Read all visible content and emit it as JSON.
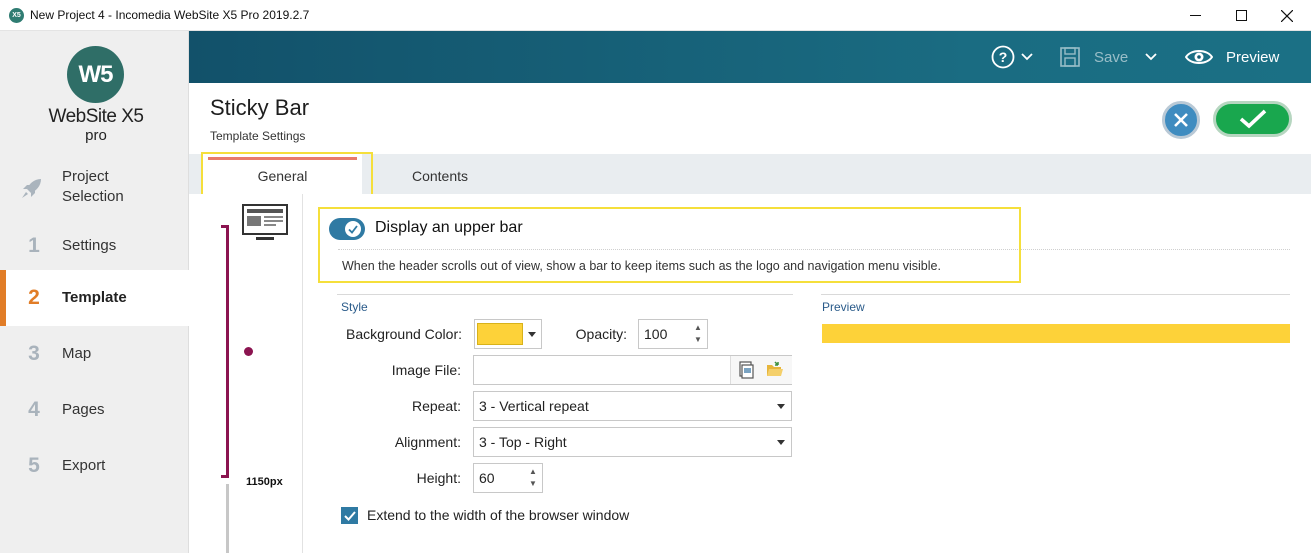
{
  "window": {
    "title": "New Project 4 - Incomedia WebSite X5 Pro 2019.2.7",
    "app_icon_text": "X5"
  },
  "logo": {
    "mark": "W5",
    "name": "WebSite X5",
    "edition": "pro"
  },
  "sidebar": {
    "project_label": "Project Selection",
    "steps": [
      {
        "num": "1",
        "label": "Settings"
      },
      {
        "num": "2",
        "label": "Template"
      },
      {
        "num": "3",
        "label": "Map"
      },
      {
        "num": "4",
        "label": "Pages"
      },
      {
        "num": "5",
        "label": "Export"
      }
    ],
    "active_step": "Template"
  },
  "toolbar": {
    "save_label": "Save",
    "preview_label": "Preview"
  },
  "header": {
    "title": "Sticky Bar",
    "subtitle": "Template Settings"
  },
  "tabs": {
    "general": "General",
    "contents": "Contents",
    "active": "General"
  },
  "device": {
    "width_label": "1150px"
  },
  "upper_bar": {
    "label": "Display an upper bar",
    "enabled": true,
    "description": "When the header scrolls out of view, show a bar to keep items such as the logo and navigation menu visible."
  },
  "style": {
    "section_label": "Style",
    "background_color_label": "Background Color:",
    "background_color": "#fdd239",
    "opacity_label": "Opacity:",
    "opacity_value": "100",
    "image_file_label": "Image File:",
    "image_file_value": "",
    "repeat_label": "Repeat:",
    "repeat_value": "3 - Vertical repeat",
    "alignment_label": "Alignment:",
    "alignment_value": "3 - Top - Right",
    "height_label": "Height:",
    "height_value": "60",
    "extend_label": "Extend to the width of the browser window",
    "extend_checked": true
  },
  "preview": {
    "section_label": "Preview",
    "bar_color": "#fdd239"
  },
  "colors": {
    "accent_orange": "#e17d27",
    "topbar": "#12516a",
    "confirm_green": "#19a74e",
    "cancel_blue": "#3f8cc0",
    "highlight_yellow": "#f5df3b"
  }
}
